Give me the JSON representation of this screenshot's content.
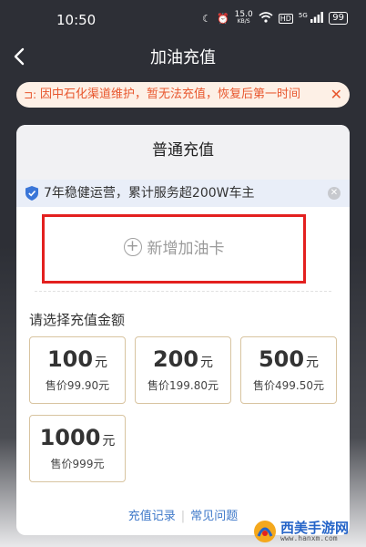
{
  "status_bar": {
    "time": "10:50",
    "net_speed_value": "15.0",
    "net_speed_unit": "KB/S",
    "hd_badge": "HD",
    "signal_label": "5G",
    "battery": "99"
  },
  "nav": {
    "title": "加油充值",
    "back_icon": "chevron-left-icon"
  },
  "notice": {
    "text": "因中石化渠道维护，暂无法充值，恢复后第一时间",
    "close_glyph": "✕",
    "accent_color": "#e8572e"
  },
  "card": {
    "title": "普通充值",
    "trust_text": "7年稳健运营，累计服务超200W车主",
    "add_card_label": "新增加油卡",
    "amount_section_label": "请选择充值金额",
    "amounts": [
      {
        "value": "100",
        "unit": "元",
        "price": "售价99.90元"
      },
      {
        "value": "200",
        "unit": "元",
        "price": "售价199.80元"
      },
      {
        "value": "500",
        "unit": "元",
        "price": "售价499.50元"
      },
      {
        "value": "1000",
        "unit": "元",
        "price": "售价999元"
      }
    ],
    "footer_links": [
      "充值记录",
      "常见问题"
    ],
    "footer_separator": "|",
    "highlight_color": "#e3201f",
    "link_color": "#3f79c9"
  },
  "watermark": {
    "name": "西美手游网",
    "url": "www.hanxm.com"
  }
}
